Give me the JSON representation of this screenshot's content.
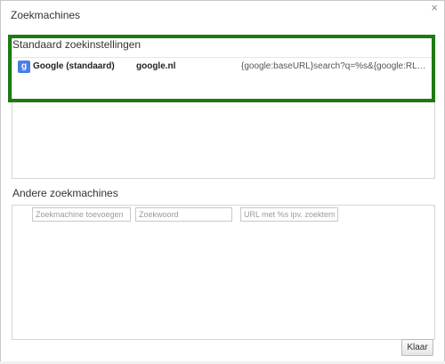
{
  "dialog": {
    "title": "Zoekmachines",
    "close_glyph": "×"
  },
  "default_section": {
    "title": "Standaard zoekinstellingen",
    "engine": {
      "icon": "google-g-icon",
      "icon_glyph": "g",
      "name": "Google (standaard)",
      "keyword": "google.nl",
      "url": "{google:baseURL}search?q=%s&{google:RLZ}{goo..."
    },
    "highlight_color": "#1e7a13"
  },
  "others_section": {
    "title": "Andere zoekmachines",
    "name_placeholder": "Zoekmachine toevoegen",
    "keyword_placeholder": "Zoekwoord",
    "url_placeholder": "URL met %s ipv. zoekterm"
  },
  "footer": {
    "done_label": "Klaar"
  }
}
